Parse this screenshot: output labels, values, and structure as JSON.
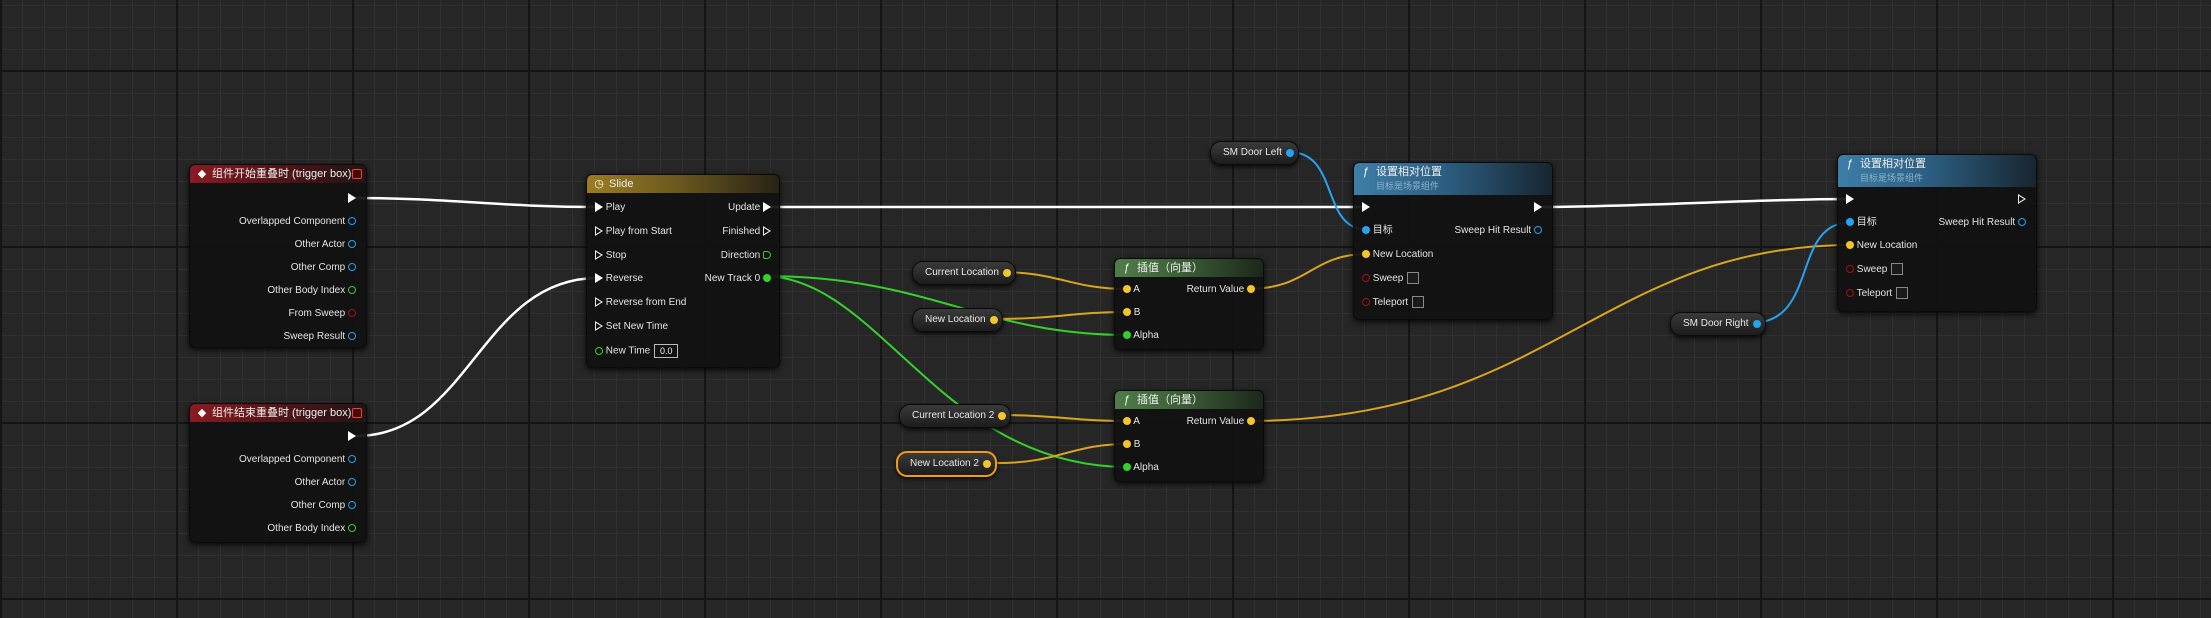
{
  "events": {
    "begin": {
      "title": "组件开始重叠时 (trigger box)",
      "pins": [
        "Overlapped Component",
        "Other Actor",
        "Other Comp",
        "Other Body Index",
        "From Sweep",
        "Sweep Result"
      ]
    },
    "end": {
      "title": "组件结束重叠时 (trigger box)",
      "pins": [
        "Overlapped Component",
        "Other Actor",
        "Other Comp",
        "Other Body Index"
      ]
    }
  },
  "timeline": {
    "title": "Slide",
    "inputs": [
      "Play",
      "Play from Start",
      "Stop",
      "Reverse",
      "Reverse from End",
      "Set New Time",
      "New Time"
    ],
    "new_time_value": "0.0",
    "outputs": [
      "Update",
      "Finished",
      "Direction",
      "New Track 0"
    ]
  },
  "lerp1": {
    "title": "插值（向量）",
    "pins": [
      "A",
      "B",
      "Alpha"
    ],
    "output": "Return Value"
  },
  "lerp2": {
    "title": "插值（向量）",
    "pins": [
      "A",
      "B",
      "Alpha"
    ],
    "output": "Return Value"
  },
  "vars": {
    "current_location": "Current Location",
    "new_location": "New Location",
    "current_location_2": "Current Location 2",
    "new_location_2": "New Location 2",
    "sm_door_left": "SM Door Left",
    "sm_door_right": "SM Door Right"
  },
  "set_left": {
    "title": "设置相对位置",
    "subtitle": "目标是场景组件",
    "pins": [
      "目标",
      "New Location",
      "Sweep",
      "Teleport"
    ],
    "output": "Sweep Hit Result"
  },
  "set_right": {
    "title": "设置相对位置",
    "subtitle": "目标是场景组件",
    "pins": [
      "目标",
      "New Location",
      "Sweep",
      "Teleport"
    ],
    "output": "Sweep Hit Result"
  },
  "colors": {
    "exec": "#ffffff",
    "vector": "#f3c52a",
    "float": "#34d12b",
    "object": "#23a3f0",
    "bool": "#9e1212",
    "event_header": "#8a1b22",
    "timeline_header": "#9c7c22",
    "pure_header": "#4f7d48",
    "function_header": "#3d7ea8",
    "selection": "#f39c12"
  },
  "icons": {
    "event": "event-diamond-icon",
    "timeline": "clock-icon",
    "function": "function-icon"
  }
}
